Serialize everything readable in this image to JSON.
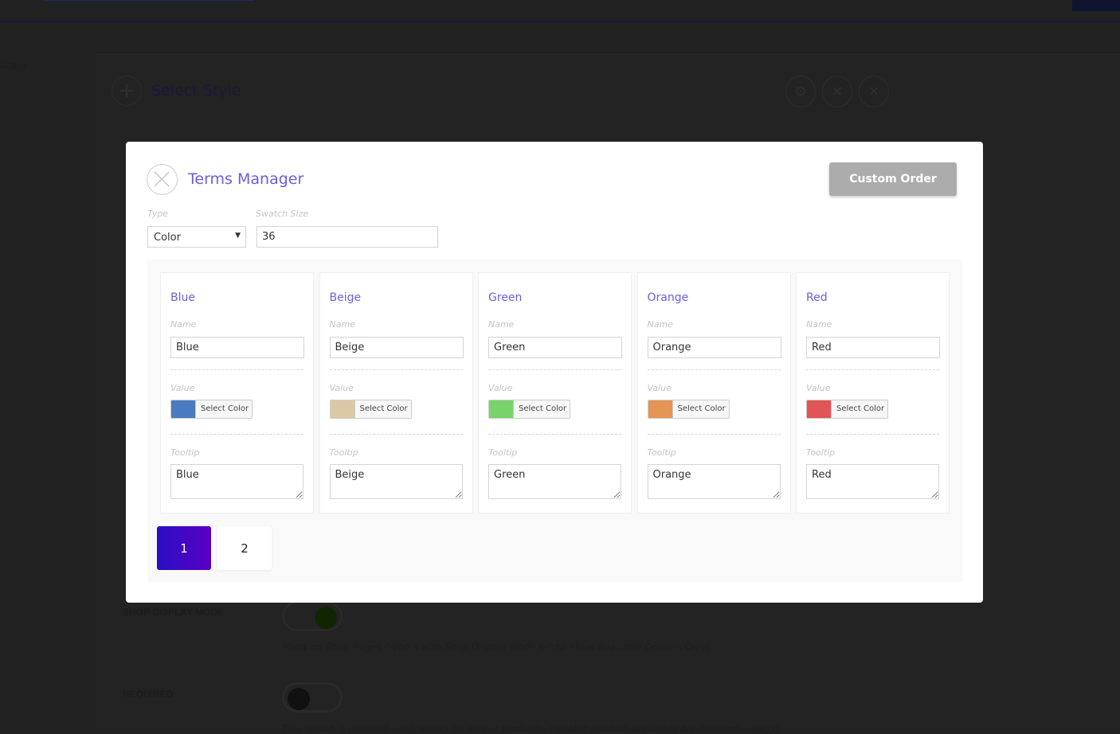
{
  "background": {
    "section_label": "AGER",
    "select_style": "Select Style",
    "shop_display_mode_label": "SHOP DISPLAY MODE",
    "shop_display_desc": "Show on Shop Pages (Works with Shop Display Mode set to Show Available Options Only)",
    "required_label": "REQUIRED",
    "required_desc": "This option is required (Only works on simple products, variable product attributes are required always)"
  },
  "modal": {
    "title": "Terms Manager",
    "custom_order_label": "Custom Order",
    "type_label": "Type",
    "type_value": "Color",
    "swatch_size_label": "Swatch Size",
    "swatch_size_value": "36",
    "field_labels": {
      "name": "Name",
      "value": "Value",
      "tooltip": "Tooltip"
    },
    "select_color_label": "Select Color",
    "terms": [
      {
        "title": "Blue",
        "name": "Blue",
        "color": "#4a7bc0",
        "tooltip": "Blue"
      },
      {
        "title": "Beige",
        "name": "Beige",
        "color": "#ddc8a6",
        "tooltip": "Beige"
      },
      {
        "title": "Green",
        "name": "Green",
        "color": "#78d46a",
        "tooltip": "Green"
      },
      {
        "title": "Orange",
        "name": "Orange",
        "color": "#e69455",
        "tooltip": "Orange"
      },
      {
        "title": "Red",
        "name": "Red",
        "color": "#e05555",
        "tooltip": "Red"
      }
    ],
    "pages": [
      "1",
      "2"
    ],
    "current_page": "1"
  }
}
